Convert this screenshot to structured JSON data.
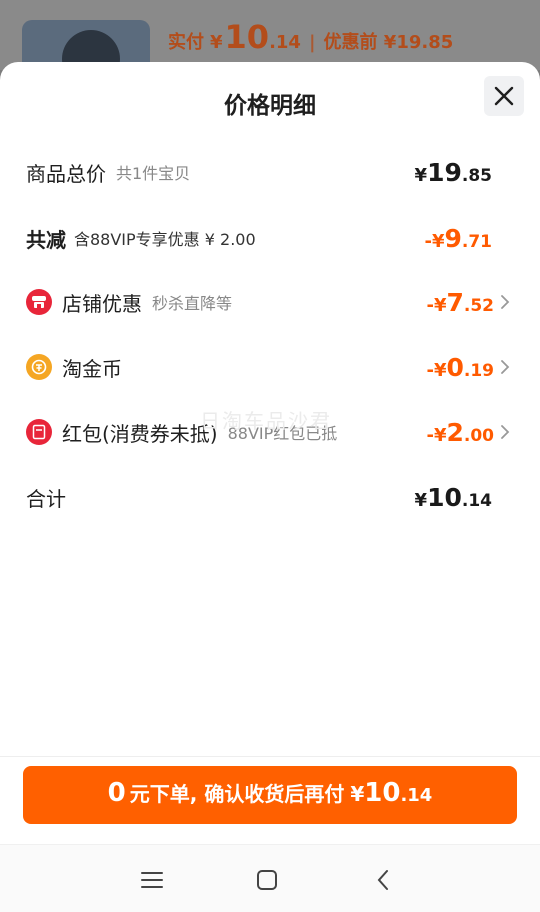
{
  "header": {
    "price_label": "实付",
    "currency": "¥",
    "price_int": "10",
    "price_dec": ".14",
    "separator": "|",
    "original_label": "优惠前 ¥19.85"
  },
  "sheet": {
    "title": "价格明细",
    "close_icon": "close-icon"
  },
  "rows": [
    {
      "label": "商品总价",
      "sub": "共1件宝贝",
      "amount_prefix": "¥",
      "amount_int": "19",
      "amount_dec": ".85"
    },
    {
      "label": "共减",
      "sub": "含88VIP专享优惠 ¥ 2.00",
      "amount_prefix": "-¥",
      "amount_int": "9",
      "amount_dec": ".71"
    },
    {
      "label": "店铺优惠",
      "sub": "秒杀直降等",
      "amount_prefix": "-¥",
      "amount_int": "7",
      "amount_dec": ".52",
      "icon": "shop-icon"
    },
    {
      "label": "淘金币",
      "sub": "",
      "amount_prefix": "-¥",
      "amount_int": "0",
      "amount_dec": ".19",
      "icon": "gold-coin-icon"
    },
    {
      "label": "红包(消费券未抵)",
      "sub": "88VIP红包已抵",
      "amount_prefix": "-¥",
      "amount_int": "2",
      "amount_dec": ".00",
      "icon": "red-envelope-icon"
    },
    {
      "label": "合计",
      "sub": "",
      "amount_prefix": "¥",
      "amount_int": "10",
      "amount_dec": ".14"
    }
  ],
  "watermark": "日淘车品沙君",
  "cta": {
    "zero": "0",
    "text": "元下单, 确认收货后再付",
    "currency": "¥",
    "amount_int": "10",
    "amount_dec": ".14"
  },
  "navbar": {
    "menu_icon": "menu-icon",
    "home_icon": "home-icon",
    "back_icon": "back-icon"
  },
  "colors": {
    "accent": "#ff6000",
    "discount": "#ff5a00",
    "shop_icon": "#e8263a",
    "coin_icon": "#f5a623",
    "envelope_icon": "#e8263a"
  }
}
